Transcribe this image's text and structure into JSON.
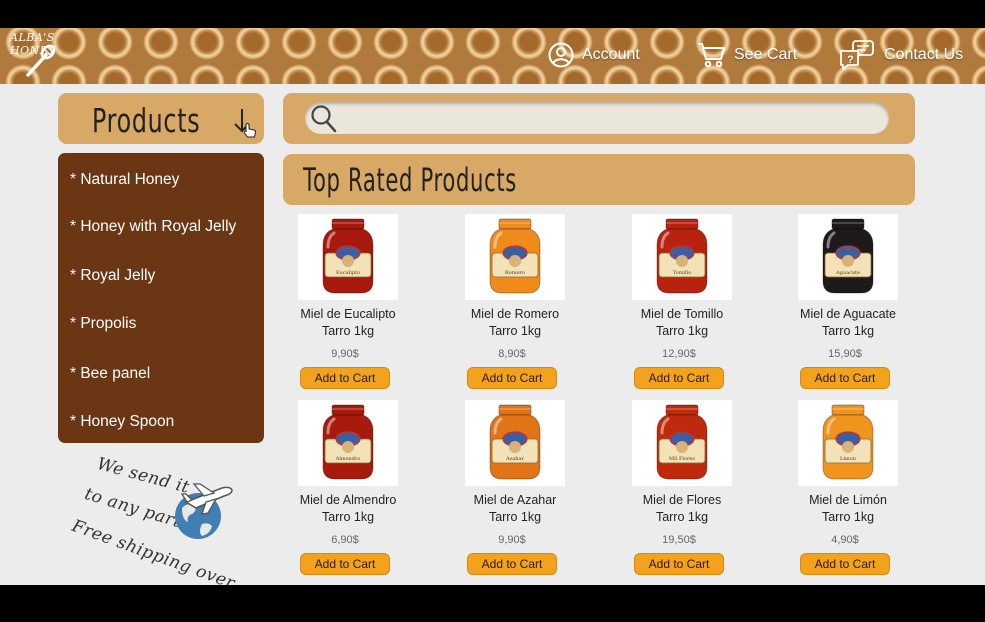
{
  "brand": {
    "name": "ALBA'S HONEY"
  },
  "nav": {
    "account": "Account",
    "cart": "See Cart",
    "contact": "Contact Us"
  },
  "products_menu": {
    "label": "Products"
  },
  "sidebar": {
    "items": [
      {
        "label": "* Natural Honey"
      },
      {
        "label": "* Honey with Royal Jelly"
      },
      {
        "label": "* Royal Jelly"
      },
      {
        "label": "* Propolis"
      },
      {
        "label": "* Bee panel"
      },
      {
        "label": "* Honey Spoon"
      }
    ]
  },
  "promo": {
    "line1": "We send it",
    "line2": "to any part",
    "line3": "Free shipping over"
  },
  "search": {
    "value": "",
    "placeholder": ""
  },
  "section": {
    "title": "Top Rated Products"
  },
  "products": [
    {
      "name": "Miel de Eucalipto",
      "size": "Tarro 1kg",
      "price": "9,90$",
      "button": "Add to Cart",
      "label": "Eucalipto",
      "honey_color": "#a8180c"
    },
    {
      "name": "Miel de Romero",
      "size": "Tarro 1kg",
      "price": "8,90$",
      "button": "Add to Cart",
      "label": "Romero",
      "honey_color": "#f08a1a"
    },
    {
      "name": "Miel de Tomillo",
      "size": "Tarro 1kg",
      "price": "12,90$",
      "button": "Add to Cart",
      "label": "Tomillo",
      "honey_color": "#b8220e"
    },
    {
      "name": "Miel de Aguacate",
      "size": "Tarro 1kg",
      "price": "15,90$",
      "button": "Add to Cart",
      "label": "Aguacate",
      "honey_color": "#1e1a1c"
    },
    {
      "name": "Miel de Almendro",
      "size": "Tarro 1kg",
      "price": "6,90$",
      "button": "Add to Cart",
      "label": "Almendro",
      "honey_color": "#a81a0c"
    },
    {
      "name": "Miel de Azahar",
      "size": "Tarro 1kg",
      "price": "9,90$",
      "button": "Add to Cart",
      "label": "Azahar",
      "honey_color": "#e27418"
    },
    {
      "name": "Miel de Flores",
      "size": "Tarro 1kg",
      "price": "19,50$",
      "button": "Add to Cart",
      "label": "Mil Flores",
      "honey_color": "#c02a0c"
    },
    {
      "name": "Miel de Limón",
      "size": "Tarro 1kg",
      "price": "4,90$",
      "button": "Add to Cart",
      "label": "Limon",
      "honey_color": "#f0941e"
    }
  ]
}
